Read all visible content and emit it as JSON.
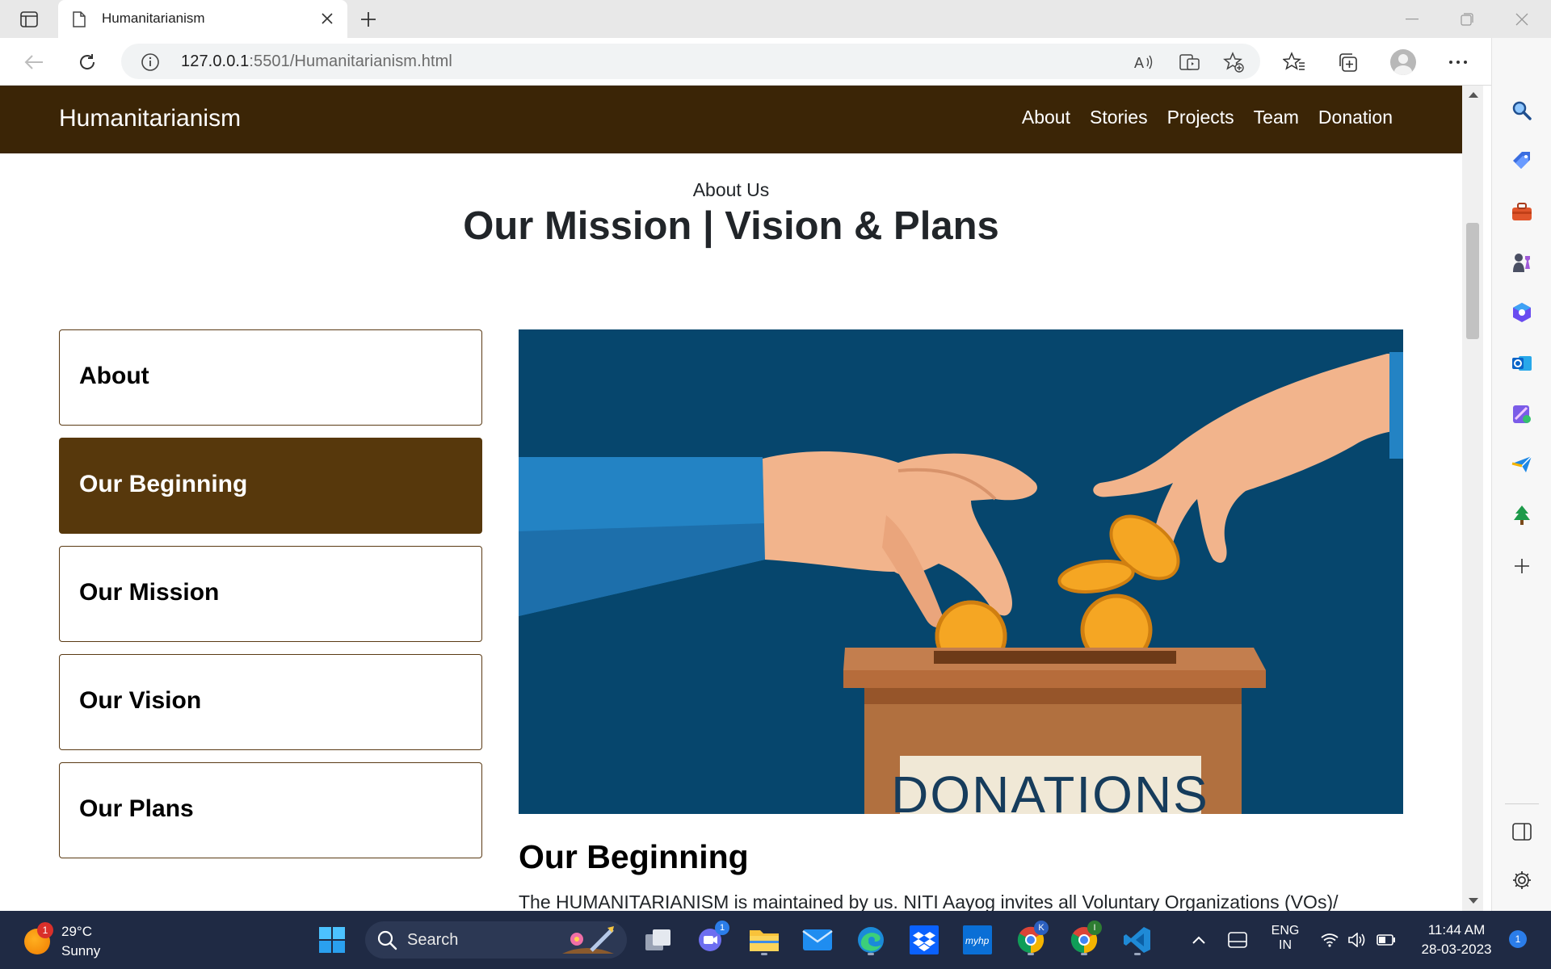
{
  "browser": {
    "tab_title": "Humanitarianism",
    "url_main": "127.0.0.1",
    "url_rest": ":5501/Humanitarianism.html",
    "icons": [
      "tab-actions-icon",
      "page-icon",
      "close-icon",
      "new-tab-icon",
      "minimize-icon",
      "restore-icon",
      "window-close-icon",
      "back-icon",
      "refresh-icon",
      "info-icon",
      "read-aloud-icon",
      "immersive-reader-icon",
      "add-favorite-icon",
      "favorites-icon",
      "collections-icon",
      "profile-icon",
      "more-icon",
      "bing-icon"
    ]
  },
  "sidebar": {
    "icons": [
      "search-icon",
      "shopping-icon",
      "tools-icon",
      "games-icon",
      "microsoft365-icon",
      "outlook-icon",
      "designer-icon",
      "send-icon",
      "tree-icon",
      "add-icon",
      "split-screen-icon",
      "settings-icon"
    ]
  },
  "site": {
    "brand": "Humanitarianism",
    "nav": [
      "About",
      "Stories",
      "Projects",
      "Team",
      "Donation"
    ],
    "eyebrow": "About Us",
    "heading": "Our Mission | Vision & Plans",
    "menu": [
      {
        "label": "About",
        "active": false
      },
      {
        "label": "Our Beginning",
        "active": true
      },
      {
        "label": "Our Mission",
        "active": false
      },
      {
        "label": "Our Vision",
        "active": false
      },
      {
        "label": "Our Plans",
        "active": false
      }
    ],
    "image_caption": "DONATIONS",
    "section_title": "Our Beginning",
    "section_body": "The HUMANITARIANISM is maintained by us. NITI Aayog invites all Voluntary Organizations (VOs)/",
    "colors": {
      "nav_bg": "#3b2506",
      "active_bg": "#57380c",
      "hero_bg": "#06466d"
    }
  },
  "taskbar": {
    "weather_temp": "29°C",
    "weather_desc": "Sunny",
    "weather_badge": "1",
    "search_label": "Search",
    "teams_badge": "1",
    "chrome_k_badge": "K",
    "chrome_i_badge": "I",
    "lang_top": "ENG",
    "lang_bottom": "IN",
    "time": "11:44 AM",
    "date": "28-03-2023",
    "notif_count": "1"
  }
}
